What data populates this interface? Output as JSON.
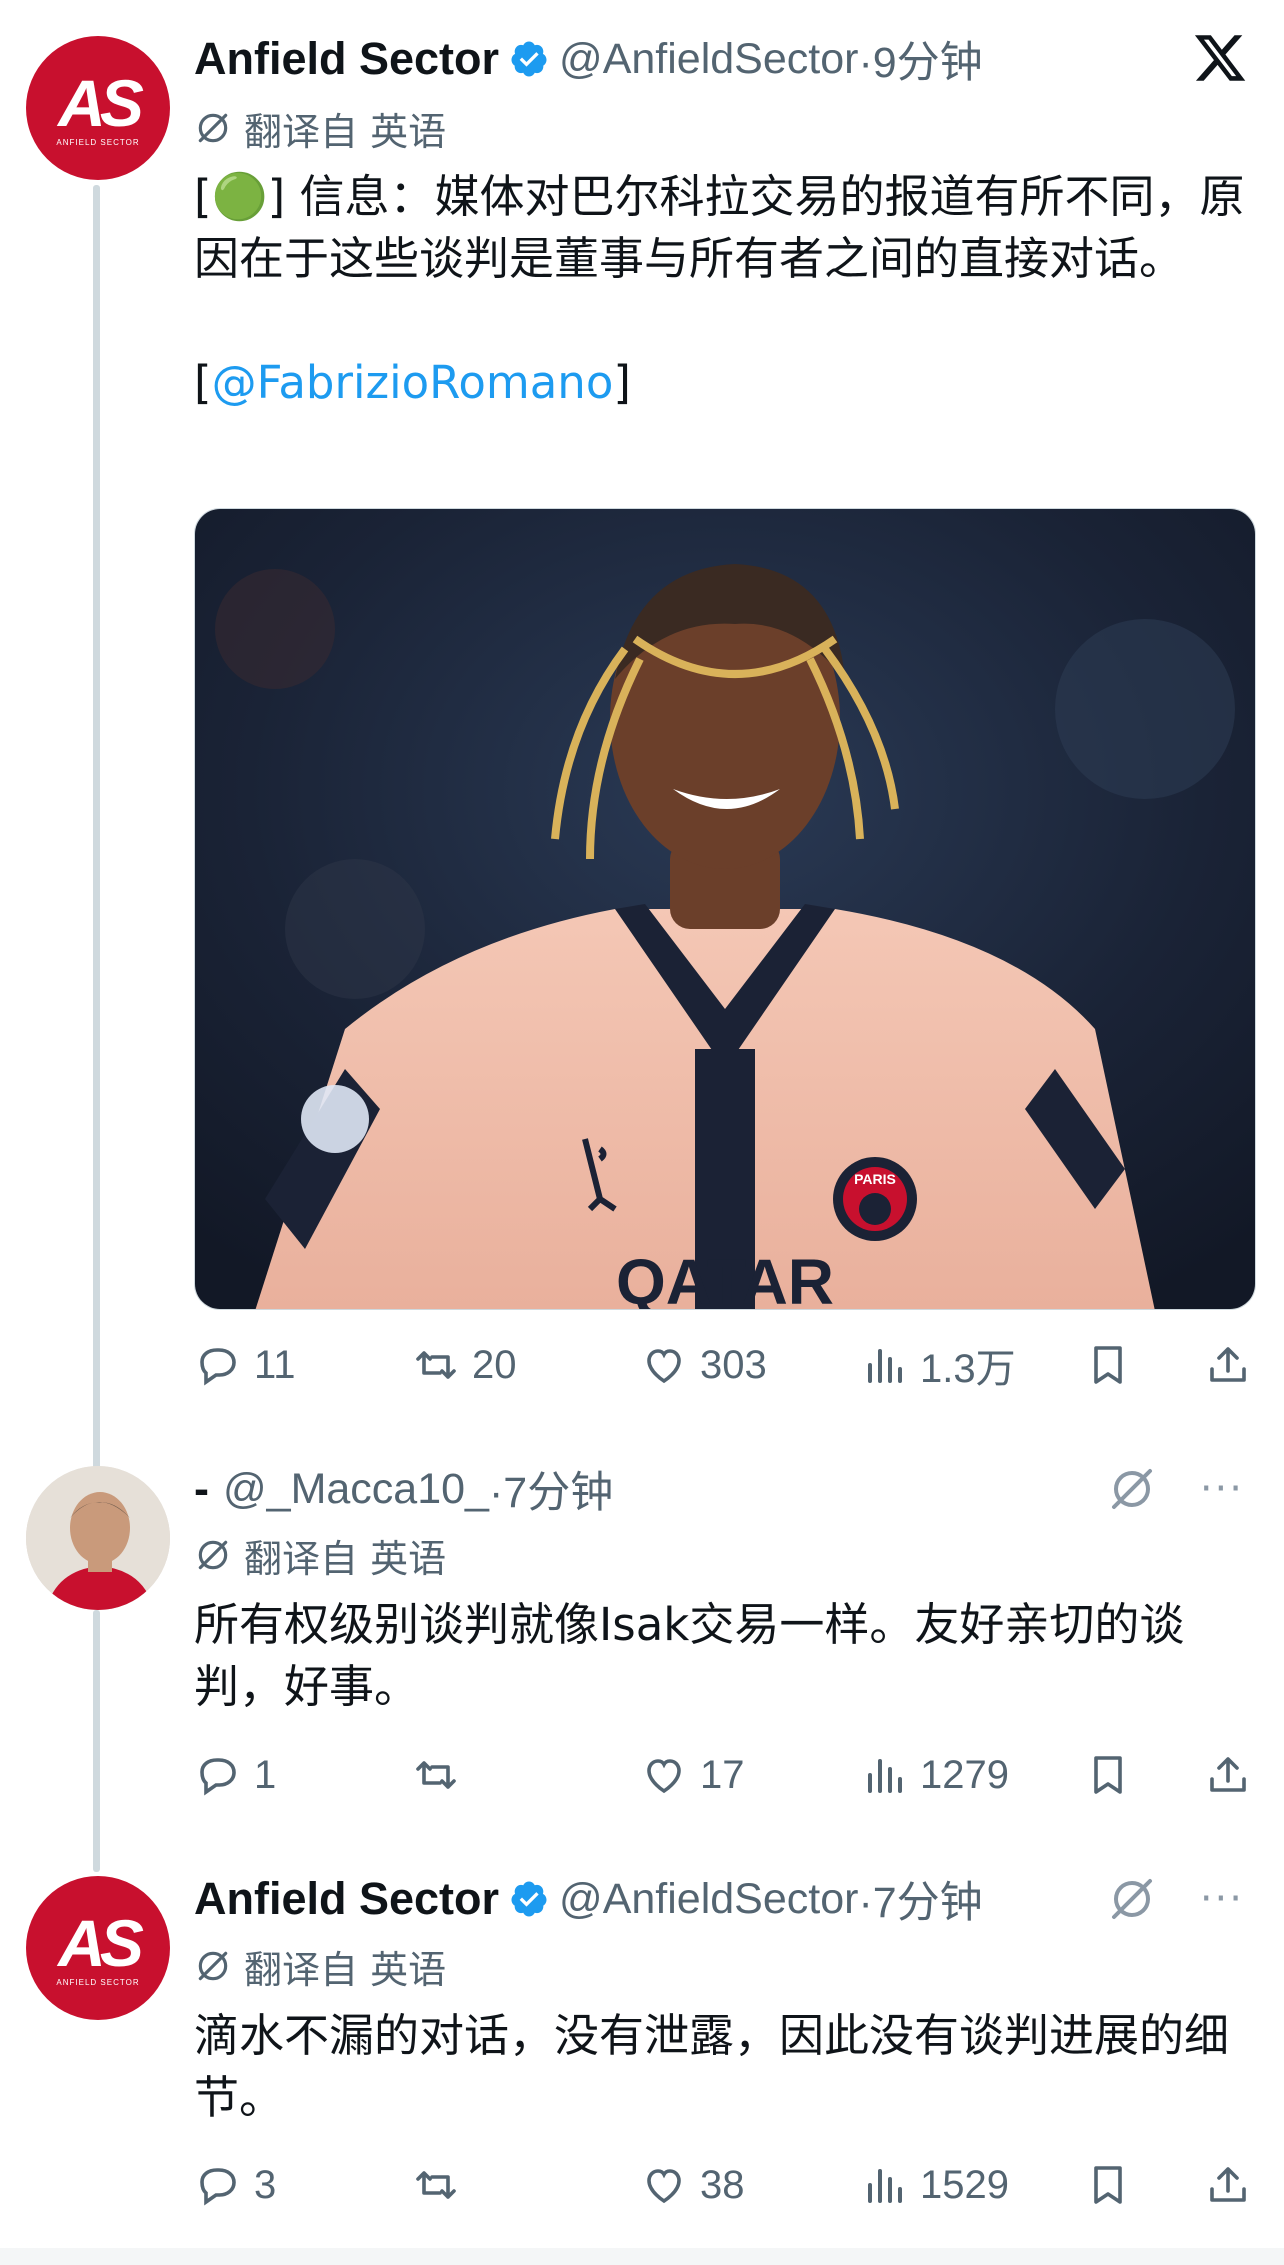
{
  "tweets": [
    {
      "display_name": "Anfield Sector",
      "handle": "@AnfieldSector",
      "time": "·9分钟",
      "translate_label": "翻译自 英语",
      "text_prefix": "[",
      "emoji": "🟢",
      "text_main": "] 信息：媒体对巴尔科拉交易的报道有所不同，原因在于这些谈判是董事与所有者之间的直接对话。",
      "text_link_open": "[",
      "mention": "@FabrizioRomano",
      "text_link_close": "]",
      "stats": {
        "replies": "11",
        "retweets": "20",
        "likes": "303",
        "views": "1.3万"
      }
    },
    {
      "dash": "-",
      "handle": "@_Macca10_",
      "time": "·7分钟",
      "translate_label": "翻译自 英语",
      "text": "所有权级别谈判就像Isak交易一样。友好亲切的谈判，好事。",
      "stats": {
        "replies": "1",
        "retweets": "",
        "likes": "17",
        "views": "1279"
      }
    },
    {
      "display_name": "Anfield Sector",
      "handle": "@AnfieldSector",
      "time": "·7分钟",
      "translate_label": "翻译自 英语",
      "text": "滴水不漏的对话，没有泄露，因此没有谈判进展的细节。",
      "stats": {
        "replies": "3",
        "retweets": "",
        "likes": "38",
        "views": "1529"
      }
    }
  ],
  "media": {
    "jersey_text": "QATAR",
    "badge_text": "PARIS",
    "colors": {
      "jersey": "#f0bfae",
      "trim": "#1b2235",
      "background": "#1e2a3d",
      "skin": "#6b3f2a",
      "hair": "#d9b25a"
    }
  },
  "icons": {
    "brand": "x-logo",
    "verified": "verified-badge-icon",
    "translate": "grok-icon",
    "reply": "reply-icon",
    "retweet": "retweet-icon",
    "like": "heart-icon",
    "views": "views-icon",
    "bookmark": "bookmark-icon",
    "share": "share-icon",
    "more": "more-icon"
  },
  "avatar": {
    "as_mark": "AS",
    "as_sub": "ANFIELD SECTOR",
    "color": "#c8102e"
  },
  "more_glyph": "···",
  "accent_color": "#1d9bf0"
}
